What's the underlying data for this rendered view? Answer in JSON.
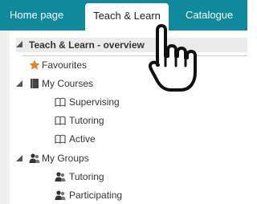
{
  "nav": {
    "tabs": [
      {
        "label": "Home page"
      },
      {
        "label": "Teach & Learn"
      },
      {
        "label": "Catalogue"
      }
    ]
  },
  "tree": {
    "overview": "Teach & Learn - overview",
    "favourites": "Favourites",
    "my_courses": "My Courses",
    "courses": [
      "Supervising",
      "Tutoring",
      "Active"
    ],
    "my_groups": "My Groups",
    "groups": [
      "Tutoring",
      "Participating"
    ]
  },
  "colors": {
    "nav_background": "#0e8a9c",
    "star": "#f07f1e"
  },
  "icons": {
    "overview": "collapse-arrow-icon",
    "favourites": "star-icon",
    "my_courses": "book-icon",
    "courses": "open-book-icon",
    "my_groups": "group-icon",
    "groups": "group-icon",
    "cursor": "hand-pointer-icon"
  }
}
